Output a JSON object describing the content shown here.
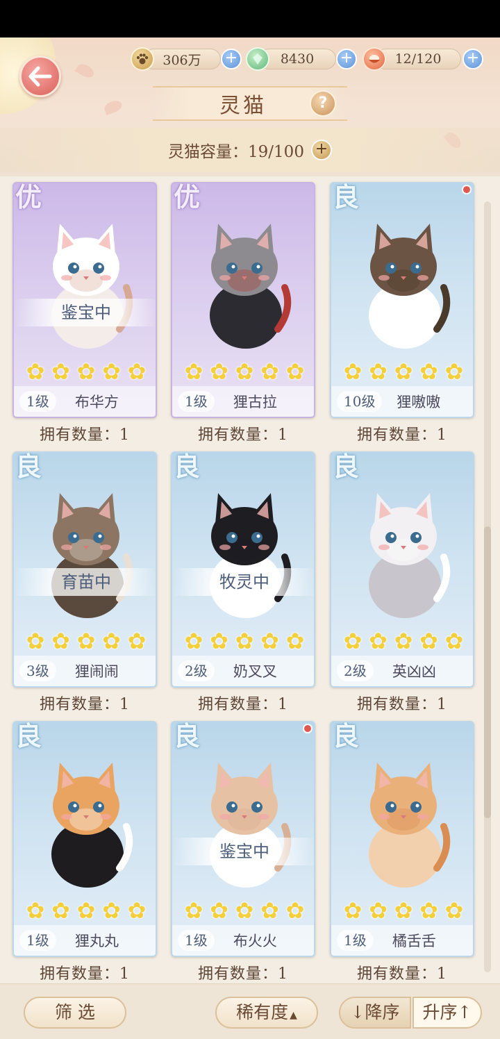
{
  "header": {
    "title": "灵猫",
    "capacity_label": "灵猫容量：19/100",
    "currencies": [
      {
        "icon": "paw-coin-icon",
        "value": "306万"
      },
      {
        "icon": "green-gem-icon",
        "value": "8430"
      },
      {
        "icon": "food-bowl-icon",
        "value": "12/120"
      }
    ]
  },
  "cats": [
    {
      "grade": "优",
      "rarity": "epic",
      "status": "鉴宝中",
      "level": "1级",
      "name": "布华方",
      "owned": "拥有数量：1",
      "stars": 5,
      "new": false,
      "colors": [
        "#ffffff",
        "#f3ece8",
        "#d8a896"
      ]
    },
    {
      "grade": "优",
      "rarity": "epic",
      "status": "",
      "level": "1级",
      "name": "狸古拉",
      "owned": "拥有数量：1",
      "stars": 5,
      "new": false,
      "colors": [
        "#8d8b8f",
        "#2b2b31",
        "#b33a35"
      ]
    },
    {
      "grade": "良",
      "rarity": "rare",
      "status": "",
      "level": "10级",
      "name": "狸嗷嗷",
      "owned": "拥有数量：1",
      "stars": 5,
      "new": true,
      "colors": [
        "#6b5443",
        "#ffffff",
        "#4a3a2c"
      ]
    },
    {
      "grade": "良",
      "rarity": "rare",
      "status": "育苗中",
      "level": "3级",
      "name": "狸闹闹",
      "owned": "拥有数量：1",
      "stars": 5,
      "new": false,
      "colors": [
        "#8c7563",
        "#5a4a3d",
        "#e9dfd4"
      ]
    },
    {
      "grade": "良",
      "rarity": "rare",
      "status": "牧灵中",
      "level": "2级",
      "name": "奶叉叉",
      "owned": "拥有数量：1",
      "stars": 5,
      "new": false,
      "colors": [
        "#1d1d22",
        "#ffffff",
        "#1d1d22"
      ]
    },
    {
      "grade": "良",
      "rarity": "rare",
      "status": "",
      "level": "2级",
      "name": "英凶凶",
      "owned": "拥有数量：1",
      "stars": 5,
      "new": false,
      "colors": [
        "#f2f0f2",
        "#c8c5cc",
        "#ffffff"
      ]
    },
    {
      "grade": "良",
      "rarity": "rare",
      "status": "",
      "level": "1级",
      "name": "狸丸丸",
      "owned": "拥有数量：1",
      "stars": 5,
      "new": false,
      "colors": [
        "#e9a461",
        "#1e1c1e",
        "#ffffff"
      ]
    },
    {
      "grade": "良",
      "rarity": "rare",
      "status": "鉴宝中",
      "level": "1级",
      "name": "布火火",
      "owned": "拥有数量：1",
      "stars": 5,
      "new": true,
      "colors": [
        "#e7c1a4",
        "#ffffff",
        "#d8b096"
      ]
    },
    {
      "grade": "良",
      "rarity": "rare",
      "status": "",
      "level": "1级",
      "name": "橘舌舌",
      "owned": "拥有数量：1",
      "stars": 5,
      "new": false,
      "colors": [
        "#eab07a",
        "#f3d0ad",
        "#d98d52"
      ]
    }
  ],
  "footer": {
    "filter_label": "筛 选",
    "rarity_label": "稀有度",
    "desc_label": "降序",
    "asc_label": "升序"
  },
  "accent_colors": {
    "epic": "#cdb9e8",
    "rare": "#b9d6ea",
    "star": "#f4cf3c",
    "plus_blue": "#5d93d8"
  }
}
